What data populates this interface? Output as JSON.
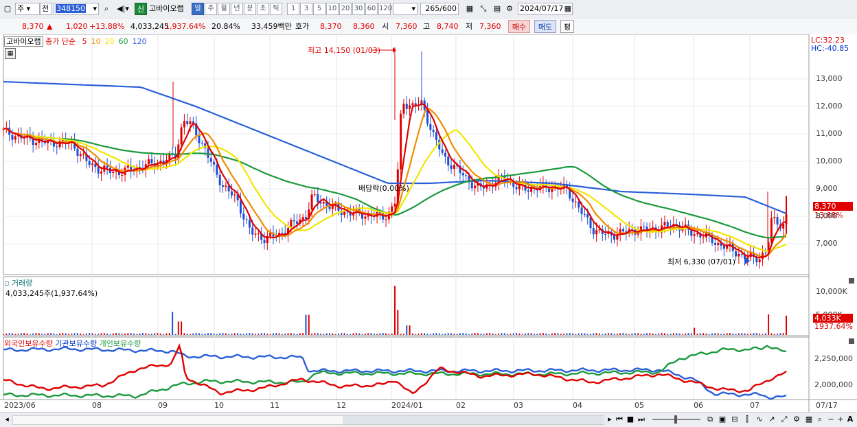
{
  "toolbar": {
    "market": "주",
    "prev_label": "전",
    "code": "348150",
    "shin_badge": "신",
    "stock_name": "고바이오랩",
    "period_tabs": [
      "일",
      "주",
      "월",
      "년",
      "분",
      "초",
      "틱"
    ],
    "active_period": "일",
    "tick_options": [
      "1",
      "3",
      "5",
      "10",
      "20",
      "30",
      "60",
      "120"
    ],
    "count": "265",
    "count_total": "/600",
    "date": "2024/07/17"
  },
  "quote": {
    "price": "8,370",
    "arrow": "▲",
    "change": "1,020",
    "change_pct": "+13.88%",
    "volume": "4,033,245",
    "volume_pct": "1,937.64%",
    "turnover": "20.84%",
    "amount": "33,459백만",
    "hoga_label": "호가",
    "ask": "8,370",
    "bid": "8,360",
    "open_label": "시",
    "open": "7,360",
    "high_label": "고",
    "high": "8,740",
    "low_label": "저",
    "low": "7,360",
    "buy_label": "매수",
    "sell_label": "매도",
    "eval_label": "평"
  },
  "price_panel": {
    "name_label": "고바이오랩",
    "legend_prefix": "종가 단순",
    "ma_periods": [
      "5",
      "10",
      "20",
      "60",
      "120"
    ],
    "ma_colors": [
      "#e00000",
      "#f08c00",
      "#f2e600",
      "#1a9a3c",
      "#2a5fd8"
    ],
    "lc": "LC:32.23",
    "hc": "HC:-40.85",
    "high_marker": "최고 14,150 (01/03)",
    "low_marker": "최저 6,330 (07/01)",
    "dividend_marker": "배당락(0.00%)",
    "last_price_tag": "8,370",
    "last_pct_tag": "13.88%",
    "y_ticks": [
      "13,000",
      "12,000",
      "11,000",
      "10,000",
      "9,000",
      "8,000",
      "7,000"
    ]
  },
  "volume_panel": {
    "title": "거래량",
    "value": "4,033,245주(1,937.64%)",
    "y_ticks": [
      "10,000K",
      "5,000K"
    ],
    "last_tag": "4,033K",
    "last_pct_tag": "1937.64%"
  },
  "holder_panel": {
    "series": [
      "외국인보유수량",
      "기관보유수량",
      "개인보유수량"
    ],
    "colors": [
      "#e00000",
      "#2a5fd8",
      "#1a9a3c"
    ],
    "y_ticks": [
      "2,250,000",
      "2,000,000"
    ]
  },
  "x_axis": [
    "2023/06",
    "08",
    "09",
    "10",
    "11",
    "12",
    "2024/01",
    "02",
    "03",
    "04",
    "05",
    "06",
    "07",
    "07/17"
  ],
  "chart_data": {
    "type": "candlestick",
    "title": "고바이오랩 (348150)",
    "x_range": [
      "2023/06",
      "2024/07/17"
    ],
    "ylim_price": [
      6000,
      14500
    ],
    "ma_series": [
      {
        "name": "5"
      },
      {
        "name": "10"
      },
      {
        "name": "20"
      },
      {
        "name": "60"
      },
      {
        "name": "120"
      }
    ],
    "close_last": 8370,
    "high": {
      "value": 14150,
      "date": "01/03"
    },
    "low": {
      "value": 6330,
      "date": "07/01"
    },
    "volume_last": 4033245,
    "volume_ylim": [
      0,
      12000000
    ],
    "holders_ylim": [
      1800000,
      2400000
    ]
  }
}
